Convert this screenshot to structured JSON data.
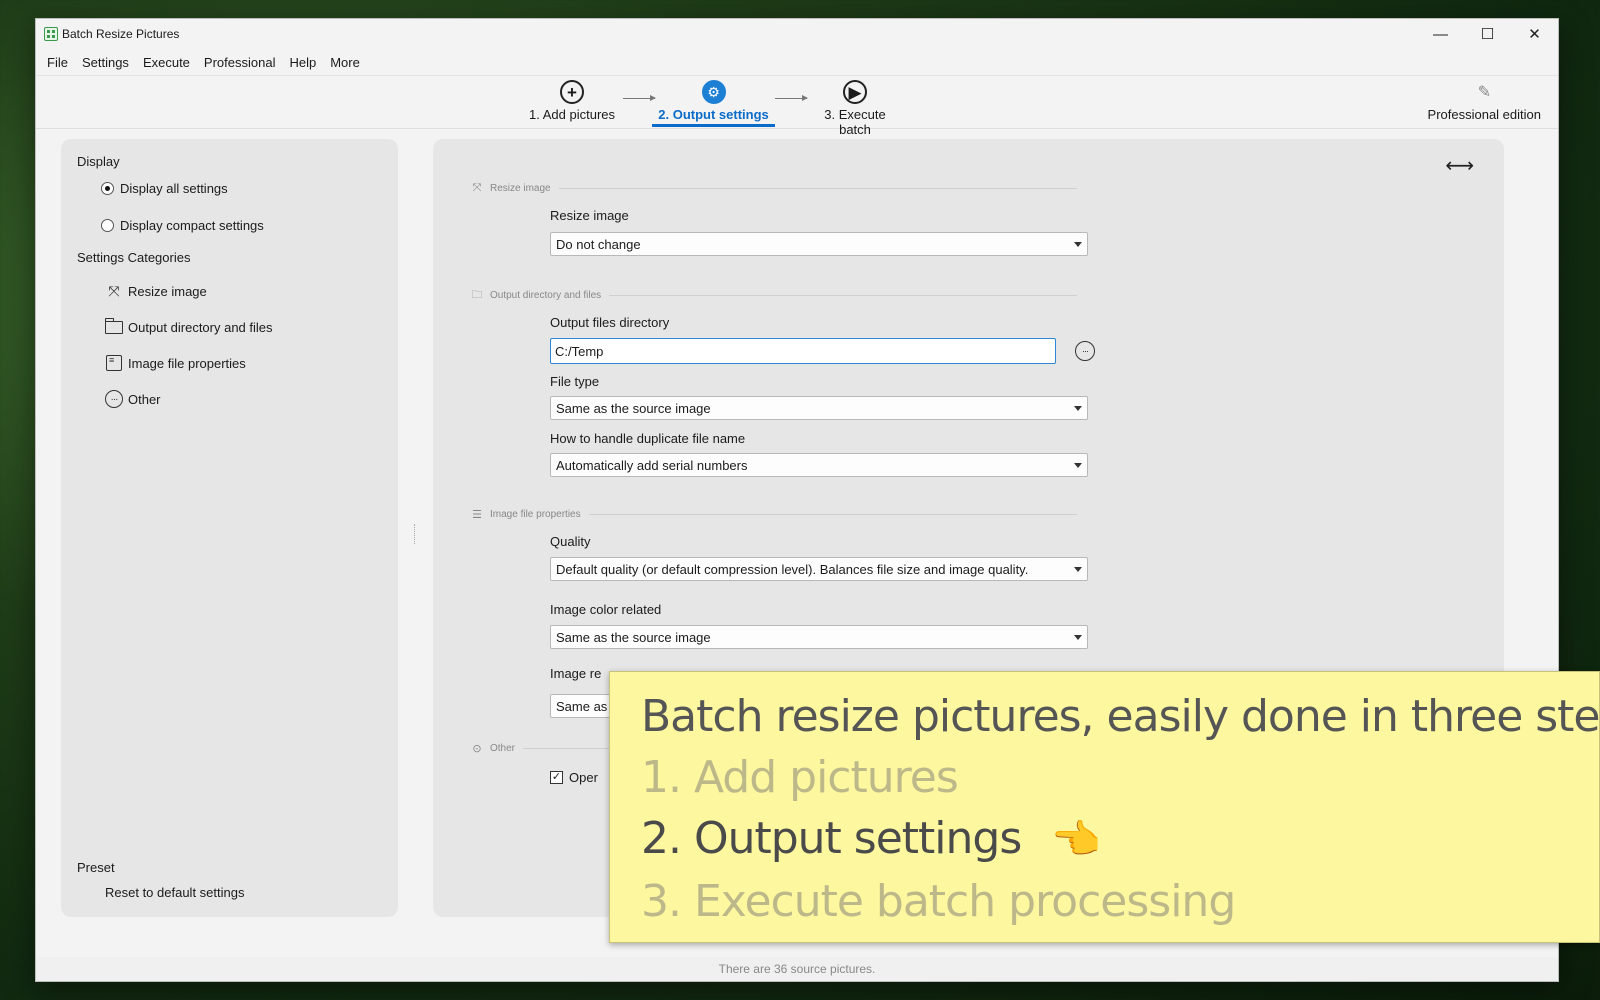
{
  "window": {
    "title": "Batch Resize Pictures",
    "controls": {
      "minimize": "—",
      "maximize": "☐",
      "close": "✕"
    }
  },
  "menu": [
    "File",
    "Settings",
    "Execute",
    "Professional",
    "Help",
    "More"
  ],
  "steps": [
    {
      "label": "1. Add pictures",
      "icon": "plus-circle-icon",
      "glyph": "+"
    },
    {
      "label": "2. Output settings",
      "icon": "gear-circle-icon",
      "glyph": "⚙",
      "active": true
    },
    {
      "label": "3. Execute batch",
      "icon": "play-circle-icon",
      "glyph": "▶"
    }
  ],
  "pro_edition": {
    "label": "Professional edition",
    "icon": "pen-icon",
    "glyph": "✎"
  },
  "left_panel": {
    "display_title": "Display",
    "display_options": [
      {
        "label": "Display all settings",
        "selected": true
      },
      {
        "label": "Display compact settings",
        "selected": false
      }
    ],
    "categories_title": "Settings Categories",
    "categories": [
      {
        "label": "Resize image",
        "icon": "resize-icon"
      },
      {
        "label": "Output directory and files",
        "icon": "folder-icon"
      },
      {
        "label": "Image file properties",
        "icon": "list-icon"
      },
      {
        "label": "Other",
        "icon": "more-circle-icon"
      }
    ],
    "preset_title": "Preset",
    "reset_label": "Reset to default settings"
  },
  "right_panel": {
    "expand_icon": "⟷",
    "groups": {
      "resize": "Resize image",
      "output": "Output directory and files",
      "properties": "Image file properties",
      "other": "Other"
    },
    "fields": {
      "resize_label": "Resize image",
      "resize_value": "Do not change",
      "output_dir_label": "Output files directory",
      "output_dir_value": "C:/Temp",
      "file_type_label": "File type",
      "file_type_value": "Same as the source image",
      "duplicate_label": "How to handle duplicate file name",
      "duplicate_value": "Automatically add serial numbers",
      "quality_label": "Quality",
      "quality_value": "Default quality (or default compression level). Balances file size and image quality.",
      "color_label": "Image color related",
      "color_value": "Same as the source image",
      "image_re_label": "Image re",
      "image_re_value": "Same as",
      "open_checkbox_label": "Oper",
      "open_checked": true
    }
  },
  "status": "There are 36 source pictures.",
  "banner": {
    "title": "Batch resize pictures, easily done in three steps!",
    "step1": "1. Add pictures",
    "step2": "2. Output settings",
    "step3": "3. Execute batch processing",
    "pointer": "👈"
  }
}
